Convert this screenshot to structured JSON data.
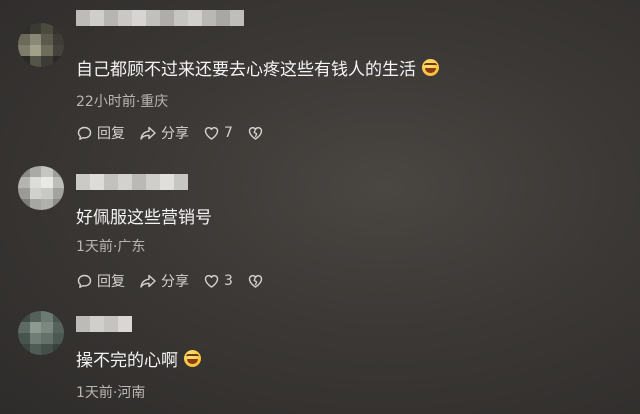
{
  "comments": [
    {
      "text": "自己都顾不过来还要去心疼这些有钱人的生活",
      "has_emoji": true,
      "emoji_icon": "laughing-crying-emoji",
      "time": "22小时前",
      "location": "重庆",
      "meta": "22小时前·重庆",
      "reply_label": "回复",
      "share_label": "分享",
      "like_count": "7",
      "avatar_colors": [
        "#2f2e2a",
        "#3a3a33",
        "#4b4a3f",
        "#35342f",
        "#6b6a5a",
        "#8a8876",
        "#5c5a4d",
        "#3d3c35",
        "#7d7b69",
        "#a3a08a",
        "#6e6c5c",
        "#44433b",
        "#2a2a27",
        "#55544a",
        "#3c3b35",
        "#2b2a27"
      ]
    },
    {
      "text": "好佩服这些营销号",
      "has_emoji": false,
      "time": "1天前",
      "location": "广东",
      "meta": "1天前·广东",
      "reply_label": "回复",
      "share_label": "分享",
      "like_count": "3",
      "avatar_colors": [
        "#8a8a86",
        "#a9a9a5",
        "#c5c5c1",
        "#9d9d99",
        "#b4b4b0",
        "#dcdcd8",
        "#e8e8e4",
        "#bcbcb8",
        "#9a9a96",
        "#d0d0cc",
        "#c8c8c4",
        "#a2a29e",
        "#7e7e7a",
        "#a6a6a2",
        "#b0b0ac",
        "#8c8c88"
      ]
    },
    {
      "text": "操不完的心啊",
      "has_emoji": true,
      "emoji_icon": "laughing-crying-emoji",
      "time": "1天前",
      "location": "河南",
      "meta": "1天前·河南",
      "avatar_colors": [
        "#3f4a45",
        "#55625b",
        "#6b7a72",
        "#4a5650",
        "#5e6b64",
        "#8c9a92",
        "#7a8880",
        "#56635d",
        "#48544e",
        "#6f7d76",
        "#63716a",
        "#4c5852",
        "#3a4540",
        "#4f5b55",
        "#45504b",
        "#384340"
      ]
    }
  ],
  "username_blur_colors": [
    [
      "#bdbcb8",
      "#cfcecb",
      "#b6b5b1",
      "#c9c8c4",
      "#d6d5d2",
      "#c1c0bc",
      "#aeadaa",
      "#c6c5c1",
      "#d1d0cc",
      "#b9b8b4",
      "#a8a7a3",
      "#bfbeba"
    ],
    [
      "#cbcac6",
      "#dddcd8",
      "#c2c1bd",
      "#d3d2ce",
      "#bab9b5",
      "#cfcecb",
      "#e0dfdb",
      "#c7c6c2"
    ],
    [
      "#bcbbb7",
      "#d0cfcb",
      "#c4c3bf",
      "#d8d7d3"
    ]
  ],
  "colors": {
    "text_primary": "#f4f4f4",
    "text_secondary": "#b9b6b2",
    "action_text": "#d6d3cf"
  }
}
